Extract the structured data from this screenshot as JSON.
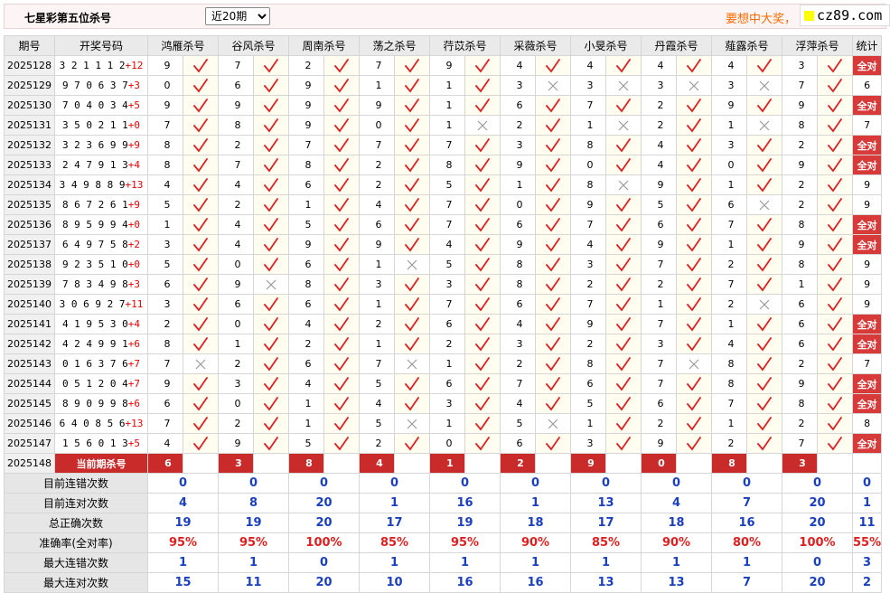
{
  "header": {
    "title": "七星彩第五位杀号",
    "period_option": "近20期",
    "promo": "要想中大奖，",
    "logo_text": "cz89.com"
  },
  "columns": [
    "期号",
    "开奖号码",
    "鸿雁杀号",
    "谷风杀号",
    "周南杀号",
    "荡之杀号",
    "荇苡杀号",
    "采薇杀号",
    "小旻杀号",
    "丹霞杀号",
    "薤露杀号",
    "浮萍杀号",
    "统计"
  ],
  "rows": [
    {
      "issue": "2025128",
      "digits": "321112",
      "sum": "+12",
      "kills": [
        9,
        7,
        2,
        7,
        9,
        4,
        4,
        4,
        4,
        3
      ],
      "hits": [
        1,
        1,
        1,
        1,
        1,
        1,
        1,
        1,
        1,
        1
      ],
      "stat": "全对"
    },
    {
      "issue": "2025129",
      "digits": "970637",
      "sum": "+3",
      "kills": [
        0,
        6,
        9,
        1,
        1,
        3,
        3,
        3,
        3,
        7
      ],
      "hits": [
        1,
        1,
        1,
        1,
        1,
        0,
        0,
        0,
        0,
        1
      ],
      "stat": "6"
    },
    {
      "issue": "2025130",
      "digits": "704034",
      "sum": "+5",
      "kills": [
        9,
        9,
        9,
        9,
        1,
        6,
        7,
        2,
        9,
        9
      ],
      "hits": [
        1,
        1,
        1,
        1,
        1,
        1,
        1,
        1,
        1,
        1
      ],
      "stat": "全对"
    },
    {
      "issue": "2025131",
      "digits": "350211",
      "sum": "+0",
      "kills": [
        7,
        8,
        9,
        0,
        1,
        2,
        1,
        2,
        1,
        8
      ],
      "hits": [
        1,
        1,
        1,
        1,
        0,
        1,
        0,
        1,
        0,
        1
      ],
      "stat": "7"
    },
    {
      "issue": "2025132",
      "digits": "323699",
      "sum": "+9",
      "kills": [
        8,
        2,
        7,
        7,
        7,
        3,
        8,
        4,
        3,
        2
      ],
      "hits": [
        1,
        1,
        1,
        1,
        1,
        1,
        1,
        1,
        1,
        1
      ],
      "stat": "全对"
    },
    {
      "issue": "2025133",
      "digits": "247913",
      "sum": "+4",
      "kills": [
        8,
        7,
        8,
        2,
        8,
        9,
        0,
        4,
        0,
        9
      ],
      "hits": [
        1,
        1,
        1,
        1,
        1,
        1,
        1,
        1,
        1,
        1
      ],
      "stat": "全对"
    },
    {
      "issue": "2025134",
      "digits": "349889",
      "sum": "+13",
      "kills": [
        4,
        4,
        6,
        2,
        5,
        1,
        8,
        9,
        1,
        2
      ],
      "hits": [
        1,
        1,
        1,
        1,
        1,
        1,
        0,
        1,
        1,
        1
      ],
      "stat": "9"
    },
    {
      "issue": "2025135",
      "digits": "867261",
      "sum": "+9",
      "kills": [
        5,
        2,
        1,
        4,
        7,
        0,
        9,
        5,
        6,
        2
      ],
      "hits": [
        1,
        1,
        1,
        1,
        1,
        1,
        1,
        1,
        0,
        1
      ],
      "stat": "9"
    },
    {
      "issue": "2025136",
      "digits": "895994",
      "sum": "+0",
      "kills": [
        1,
        4,
        5,
        6,
        7,
        6,
        7,
        6,
        7,
        8
      ],
      "hits": [
        1,
        1,
        1,
        1,
        1,
        1,
        1,
        1,
        1,
        1
      ],
      "stat": "全对"
    },
    {
      "issue": "2025137",
      "digits": "649758",
      "sum": "+2",
      "kills": [
        3,
        4,
        9,
        9,
        4,
        9,
        4,
        9,
        1,
        9
      ],
      "hits": [
        1,
        1,
        1,
        1,
        1,
        1,
        1,
        1,
        1,
        1
      ],
      "stat": "全对"
    },
    {
      "issue": "2025138",
      "digits": "923510",
      "sum": "+0",
      "kills": [
        5,
        0,
        6,
        1,
        5,
        8,
        3,
        7,
        2,
        8
      ],
      "hits": [
        1,
        1,
        1,
        0,
        1,
        1,
        1,
        1,
        1,
        1
      ],
      "stat": "9"
    },
    {
      "issue": "2025139",
      "digits": "783498",
      "sum": "+3",
      "kills": [
        6,
        9,
        8,
        3,
        3,
        8,
        2,
        2,
        7,
        1
      ],
      "hits": [
        1,
        0,
        1,
        1,
        1,
        1,
        1,
        1,
        1,
        1
      ],
      "stat": "9"
    },
    {
      "issue": "2025140",
      "digits": "306927",
      "sum": "+11",
      "kills": [
        3,
        6,
        6,
        1,
        7,
        6,
        7,
        1,
        2,
        6
      ],
      "hits": [
        1,
        1,
        1,
        1,
        1,
        1,
        1,
        1,
        0,
        1
      ],
      "stat": "9"
    },
    {
      "issue": "2025141",
      "digits": "419530",
      "sum": "+4",
      "kills": [
        2,
        0,
        4,
        2,
        6,
        4,
        9,
        7,
        1,
        6
      ],
      "hits": [
        1,
        1,
        1,
        1,
        1,
        1,
        1,
        1,
        1,
        1
      ],
      "stat": "全对"
    },
    {
      "issue": "2025142",
      "digits": "424991",
      "sum": "+6",
      "kills": [
        8,
        1,
        2,
        1,
        2,
        3,
        2,
        3,
        4,
        6
      ],
      "hits": [
        1,
        1,
        1,
        1,
        1,
        1,
        1,
        1,
        1,
        1
      ],
      "stat": "全对"
    },
    {
      "issue": "2025143",
      "digits": "016376",
      "sum": "+7",
      "kills": [
        7,
        2,
        6,
        7,
        1,
        2,
        8,
        7,
        8,
        2
      ],
      "hits": [
        0,
        1,
        1,
        0,
        1,
        1,
        1,
        0,
        1,
        1
      ],
      "stat": "7"
    },
    {
      "issue": "2025144",
      "digits": "051204",
      "sum": "+7",
      "kills": [
        9,
        3,
        4,
        5,
        6,
        7,
        6,
        7,
        8,
        9
      ],
      "hits": [
        1,
        1,
        1,
        1,
        1,
        1,
        1,
        1,
        1,
        1
      ],
      "stat": "全对"
    },
    {
      "issue": "2025145",
      "digits": "890998",
      "sum": "+6",
      "kills": [
        6,
        0,
        1,
        4,
        3,
        4,
        5,
        6,
        7,
        8
      ],
      "hits": [
        1,
        1,
        1,
        1,
        1,
        1,
        1,
        1,
        1,
        1
      ],
      "stat": "全对"
    },
    {
      "issue": "2025146",
      "digits": "640856",
      "sum": "+13",
      "kills": [
        7,
        2,
        1,
        5,
        1,
        5,
        1,
        2,
        1,
        2
      ],
      "hits": [
        1,
        1,
        1,
        0,
        1,
        0,
        1,
        1,
        1,
        1
      ],
      "stat": "8"
    },
    {
      "issue": "2025147",
      "digits": "156013",
      "sum": "+5",
      "kills": [
        4,
        9,
        5,
        2,
        0,
        6,
        3,
        9,
        2,
        7
      ],
      "hits": [
        1,
        1,
        1,
        1,
        1,
        1,
        1,
        1,
        1,
        1
      ],
      "stat": "全对"
    }
  ],
  "current": {
    "issue": "2025148",
    "label": "当前期杀号",
    "kills": [
      6,
      3,
      8,
      4,
      1,
      2,
      9,
      0,
      8,
      3
    ]
  },
  "summary": [
    {
      "label": "目前连错次数",
      "values": [
        "0",
        "0",
        "0",
        "0",
        "0",
        "0",
        "0",
        "0",
        "0",
        "0",
        "0"
      ],
      "red": false
    },
    {
      "label": "目前连对次数",
      "values": [
        "4",
        "8",
        "20",
        "1",
        "16",
        "1",
        "13",
        "4",
        "7",
        "20",
        "1"
      ],
      "red": false
    },
    {
      "label": "总正确次数",
      "values": [
        "19",
        "19",
        "20",
        "17",
        "19",
        "18",
        "17",
        "18",
        "16",
        "20",
        "11"
      ],
      "red": false
    },
    {
      "label": "准确率(全对率)",
      "values": [
        "95%",
        "95%",
        "100%",
        "85%",
        "95%",
        "90%",
        "85%",
        "90%",
        "80%",
        "100%",
        "55%"
      ],
      "red": true
    },
    {
      "label": "最大连错次数",
      "values": [
        "1",
        "1",
        "0",
        "1",
        "1",
        "1",
        "1",
        "1",
        "1",
        "0",
        "3"
      ],
      "red": false
    },
    {
      "label": "最大连对次数",
      "values": [
        "15",
        "11",
        "20",
        "10",
        "16",
        "16",
        "13",
        "13",
        "7",
        "20",
        "2"
      ],
      "red": false
    }
  ],
  "colors": {
    "check": "#e02020",
    "cross": "#9a9a9a",
    "full": "#d83a3a",
    "current": "#c92b2b",
    "summary": "#1a3fbf"
  }
}
